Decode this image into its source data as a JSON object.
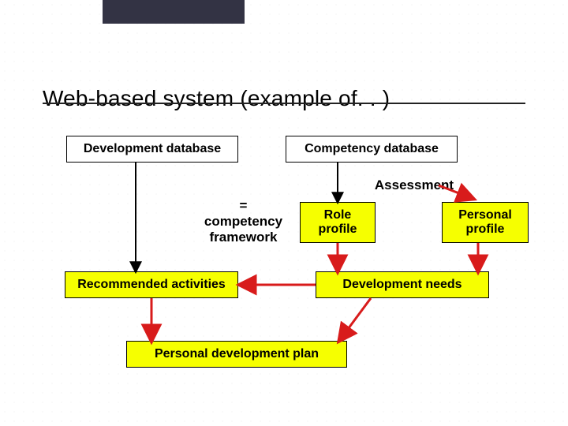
{
  "title": "Web-based system (example of. . )",
  "boxes": {
    "dev_db": "Development database",
    "comp_db": "Competency database",
    "role_profile": "Role\nprofile",
    "personal_profile": "Personal\nprofile",
    "rec_activities": "Recommended activities",
    "dev_needs": "Development needs",
    "pdp": "Personal development plan"
  },
  "labels": {
    "assessment": "Assessment",
    "eq_comp_framework": "=\ncompetency\nframework"
  },
  "colors": {
    "highlight": "#f6ff00",
    "arrow_red": "#d81b1b",
    "arrow_black": "#000000"
  }
}
